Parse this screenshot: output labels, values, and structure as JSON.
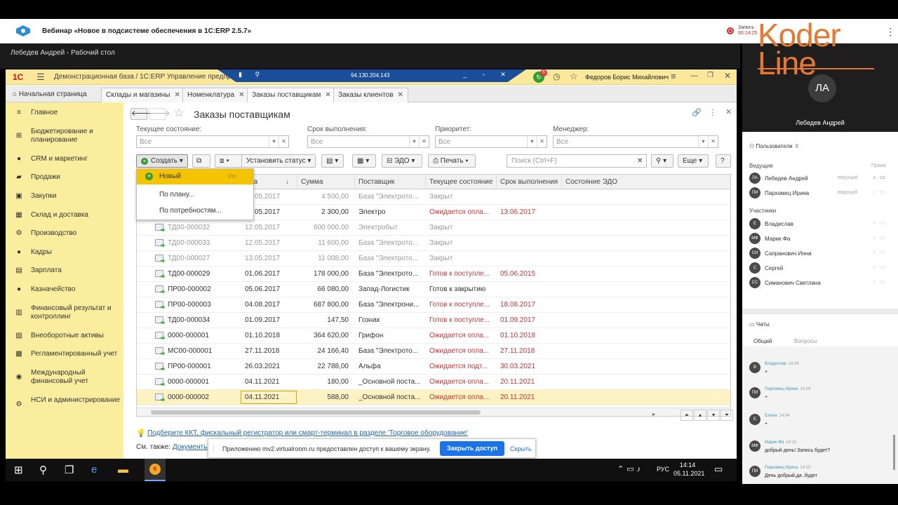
{
  "webinar": {
    "title": "Вебинар «Новое в подсистеме обеспечения в 1С:ERP 2.5.7»",
    "rec_label": "Запись",
    "rec_time": "00:14:25",
    "presenter_name": "Лебедев Андрей",
    "avatar_initials": "ЛА",
    "logo_text1": "Koder",
    "logo_text2": "Line"
  },
  "desktop": {
    "title": "Лебедев Андрей - Рабочий стол"
  },
  "window": {
    "logo": "1С",
    "title": "Демонстрационная база / 1С:ERP Управление предприятием 2 (1С:Предприятие)",
    "remote_ip": "94.130.204.143",
    "notif_count": "6",
    "user": "Федоров Борис Михайлович"
  },
  "tabs": [
    {
      "label": "Начальная страница"
    },
    {
      "label": "Склады и магазины"
    },
    {
      "label": "Номенклатура"
    },
    {
      "label": "Заказы поставщикам"
    },
    {
      "label": "Заказы клиентов"
    }
  ],
  "sidebar": [
    {
      "label": "Главное",
      "icon": "home-icon"
    },
    {
      "label": "Бюджетирование и планирование",
      "icon": "budget-icon"
    },
    {
      "label": "CRM и маркетинг",
      "icon": "crm-icon"
    },
    {
      "label": "Продажи",
      "icon": "sales-icon"
    },
    {
      "label": "Закупки",
      "icon": "purchases-icon"
    },
    {
      "label": "Склад и доставка",
      "icon": "warehouse-icon"
    },
    {
      "label": "Производство",
      "icon": "production-icon"
    },
    {
      "label": "Кадры",
      "icon": "staff-icon"
    },
    {
      "label": "Зарплата",
      "icon": "salary-icon"
    },
    {
      "label": "Казначейство",
      "icon": "treasury-icon"
    },
    {
      "label": "Финансовый результат и контроллинг",
      "icon": "finance-icon"
    },
    {
      "label": "Внеоборотные активы",
      "icon": "assets-icon"
    },
    {
      "label": "Регламентированный учет",
      "icon": "accounting-icon"
    },
    {
      "label": "Международный финансовый учет",
      "icon": "intl-icon"
    },
    {
      "label": "НСИ и администрирование",
      "icon": "admin-icon"
    }
  ],
  "page": {
    "title": "Заказы поставщикам"
  },
  "filters": [
    {
      "label": "Текущее состояние:",
      "value": "Все"
    },
    {
      "label": "Срок выполнения:",
      "value": "Все"
    },
    {
      "label": "Приоритет:",
      "value": "Все"
    },
    {
      "label": "Менеджер:",
      "value": "Все"
    }
  ],
  "toolbar": {
    "create": "Создать",
    "set_status": "Установить статус",
    "edo": "ЭДО",
    "print": "Печать",
    "search_placeholder": "Поиск (Ctrl+F)",
    "more": "Еще",
    "help": "?"
  },
  "dropdown": {
    "items": [
      "Новый",
      "По плану...",
      "По потребностям..."
    ],
    "shortcut": "Ins"
  },
  "table": {
    "headers": [
      "Дата",
      "Сумма",
      "Поставщик",
      "Текущее состояние",
      "Срок выполнения",
      "Состояние ЭДО"
    ],
    "rows": [
      {
        "num": "",
        "date": "05.05.2017",
        "sum": "4 500,00",
        "supplier": "База \"Электрото...",
        "state": "Закрыт",
        "due": ""
      },
      {
        "num": "",
        "date": "05.05.2017",
        "sum": "2 300,00",
        "supplier": "Электро",
        "state": "Ожидается опла...",
        "due": "13.06.2017"
      },
      {
        "num": "ТД00-000032",
        "date": "12.05.2017",
        "sum": "600 000,00",
        "supplier": "Электробыт",
        "state": "Закрыт",
        "due": ""
      },
      {
        "num": "ТД00-000033",
        "date": "12.05.2017",
        "sum": "11 600,00",
        "supplier": "База \"Электрото...",
        "state": "Закрыт",
        "due": ""
      },
      {
        "num": "ТД00-000027",
        "date": "13.05.2017",
        "sum": "11 008,00",
        "supplier": "База \"Электрото...",
        "state": "Закрыт",
        "due": ""
      },
      {
        "num": "ТД00-000029",
        "date": "01.06.2017",
        "sum": "178 000,00",
        "supplier": "База \"Электрото...",
        "state": "Готов к поступле...",
        "due": "05.06.2015"
      },
      {
        "num": "ПР00-000002",
        "date": "05.06.2017",
        "sum": "66 080,00",
        "supplier": "Запад-Логистик",
        "state": "Готов к закрытию",
        "due": ""
      },
      {
        "num": "ПР00-000003",
        "date": "04.08.2017",
        "sum": "687 800,00",
        "supplier": "База \"Электрони...",
        "state": "Готов к поступле...",
        "due": "18.08.2017"
      },
      {
        "num": "ТД00-000034",
        "date": "01.09.2017",
        "sum": "147,50",
        "supplier": "Гознак",
        "state": "Готов к поступле...",
        "due": "01.09.2017"
      },
      {
        "num": "0000-000001",
        "date": "01.10.2018",
        "sum": "364 620,00",
        "supplier": "Грифон",
        "state": "Ожидается опла...",
        "due": "01.10.2018"
      },
      {
        "num": "МС00-000001",
        "date": "27.11.2018",
        "sum": "24 166,40",
        "supplier": "База \"Электрото...",
        "state": "Ожидается опла...",
        "due": "27.11.2018"
      },
      {
        "num": "ПР00-000001",
        "date": "26.03.2021",
        "sum": "22 788,00",
        "supplier": "Альфа",
        "state": "Ожидается подт...",
        "due": "30.03.2021"
      },
      {
        "num": "0000-000001",
        "date": "04.11.2021",
        "sum": "180,00",
        "supplier": "_Основной поста...",
        "state": "Ожидается опла...",
        "due": "20.11.2021"
      },
      {
        "num": "0000-000002",
        "date": "04.11.2021",
        "sum": "588,00",
        "supplier": "_Основной поста...",
        "state": "Ожидается опла...",
        "due": "20.11.2021"
      }
    ]
  },
  "footer": {
    "hint": "Подберите ККТ, фискальный регистратор или смарт-терминал в разделе 'Торговое оборудование'",
    "see_also": "См. также:",
    "see_also_link": "Документы з"
  },
  "share": {
    "text": "Приложению mv2.virtualroom.ru предоставлен доступ к вашему экрану.",
    "stop": "Закрыть доступ",
    "hide": "Скрыть"
  },
  "taskbar": {
    "lang": "РУС",
    "time": "14:14",
    "date": "05.11.2021",
    "app_badge": "6"
  },
  "participants": {
    "title": "Пользователи",
    "count": "8",
    "hosts_label": "Ведущие",
    "rights_label": "Права",
    "hosts": [
      {
        "initials": "ЛА",
        "name": "Лебедев Андрей",
        "role": "ведущий"
      },
      {
        "initials": "ПИ",
        "name": "Пархомец Ирина",
        "role": "ведущий"
      }
    ],
    "members_label": "Участники",
    "members": [
      {
        "initials": "Е",
        "name": "Владислав"
      },
      {
        "initials": "МФ",
        "name": "Марик Фа"
      },
      {
        "initials": "СИ",
        "name": "Сапранович Инна"
      },
      {
        "initials": "С",
        "name": "Сергей"
      },
      {
        "initials": "СС",
        "name": "Симанович Светлана"
      }
    ]
  },
  "chat": {
    "title": "Чаты",
    "tabs": [
      "Общий",
      "Вопросы"
    ],
    "messages": [
      {
        "initials": "В",
        "name": "Владислав",
        "time": "14:04",
        "text": "+"
      },
      {
        "initials": "ПИ",
        "name": "Пархомец Ирина",
        "time": "14:04",
        "text": "+"
      },
      {
        "initials": "Е",
        "name": "Елена",
        "time": "14:04",
        "text": "+"
      },
      {
        "initials": "МФ",
        "name": "Марик Фа",
        "time": "14:10",
        "text": "добрый день! Запись будет?"
      },
      {
        "initials": "ПИ",
        "name": "Пархомец Ирина",
        "time": "14:10",
        "text": "День добрый,да ,будет"
      }
    ]
  }
}
